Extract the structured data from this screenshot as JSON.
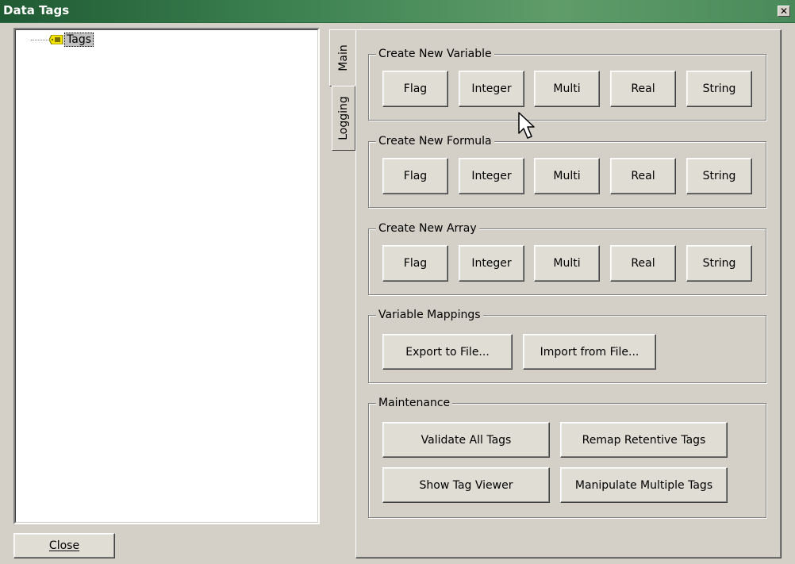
{
  "window": {
    "title": "Data Tags"
  },
  "tree": {
    "root_label": "Tags"
  },
  "close_button": {
    "label": "Close"
  },
  "tabs": [
    {
      "label": "Main"
    },
    {
      "label": "Logging"
    }
  ],
  "groups": {
    "variable": {
      "title": "Create New Variable",
      "buttons": [
        "Flag",
        "Integer",
        "Multi",
        "Real",
        "String"
      ]
    },
    "formula": {
      "title": "Create New Formula",
      "buttons": [
        "Flag",
        "Integer",
        "Multi",
        "Real",
        "String"
      ]
    },
    "array": {
      "title": "Create New Array",
      "buttons": [
        "Flag",
        "Integer",
        "Multi",
        "Real",
        "String"
      ]
    },
    "mappings": {
      "title": "Variable Mappings",
      "export": "Export to File...",
      "import": "Import from File..."
    },
    "maintenance": {
      "title": "Maintenance",
      "validate": "Validate All Tags",
      "remap": "Remap Retentive Tags",
      "viewer": "Show Tag Viewer",
      "manipulate": "Manipulate Multiple Tags"
    }
  },
  "colors": {
    "titlebar": "#3c8050",
    "face": "#d4d0c8",
    "tag_icon": "#f5e400"
  }
}
